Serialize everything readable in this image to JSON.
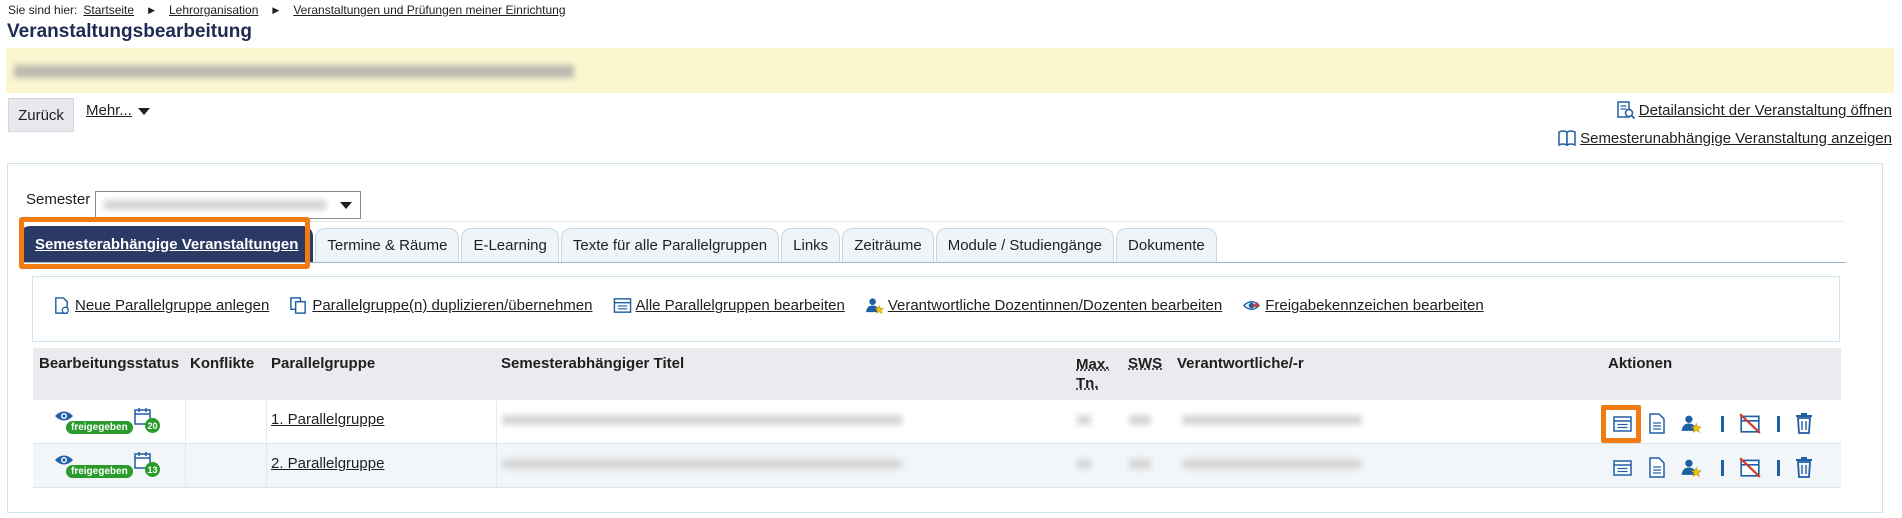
{
  "breadcrumb": {
    "prefix": "Sie sind hier:",
    "items": [
      "Startseite",
      "Lehrorganisation",
      "Veranstaltungen und Prüfungen meiner Einrichtung"
    ]
  },
  "page": {
    "title": "Veranstaltungsbearbeitung"
  },
  "toolbar": {
    "back_label": "Zurück",
    "more_label": "Mehr..."
  },
  "links": {
    "detail": "Detailansicht der Veranstaltung öffnen",
    "independent": "Semesterunabhängige Veranstaltung anzeigen"
  },
  "semester": {
    "label": "Semester"
  },
  "tabs": [
    {
      "label": "Semesterabhängige Veranstaltungen",
      "active": true
    },
    {
      "label": "Termine & Räume"
    },
    {
      "label": "E-Learning"
    },
    {
      "label": "Texte für alle Parallelgruppen"
    },
    {
      "label": "Links"
    },
    {
      "label": "Zeiträume"
    },
    {
      "label": "Module / Studiengänge"
    },
    {
      "label": "Dokumente"
    }
  ],
  "actions": {
    "new_group": "Neue Parallelgruppe anlegen",
    "duplicate": "Parallelgruppe(n) duplizieren/übernehmen",
    "edit_all": "Alle Parallelgruppen bearbeiten",
    "responsible": "Verantwortliche Dozentinnen/Dozenten bearbeiten",
    "release": "Freigabekennzeichen bearbeiten"
  },
  "table": {
    "headers": {
      "status": "Bearbeitungsstatus",
      "conflicts": "Konflikte",
      "group": "Parallelgruppe",
      "title": "Semesterabhängiger Titel",
      "max1": "Max.",
      "max2": "Tn.",
      "sws": "SWS",
      "responsible": "Verantwortliche/-r",
      "actions": "Aktionen"
    },
    "rows": [
      {
        "badge": "freigegeben",
        "count": "20",
        "group": "1. Parallelgruppe"
      },
      {
        "badge": "freigegeben",
        "count": "13",
        "group": "2. Parallelgruppe"
      }
    ]
  },
  "colors": {
    "accent": "#2b3a64",
    "highlight": "#f07b10",
    "status_green": "#2a9a2a",
    "banner": "#fbf6cf"
  }
}
